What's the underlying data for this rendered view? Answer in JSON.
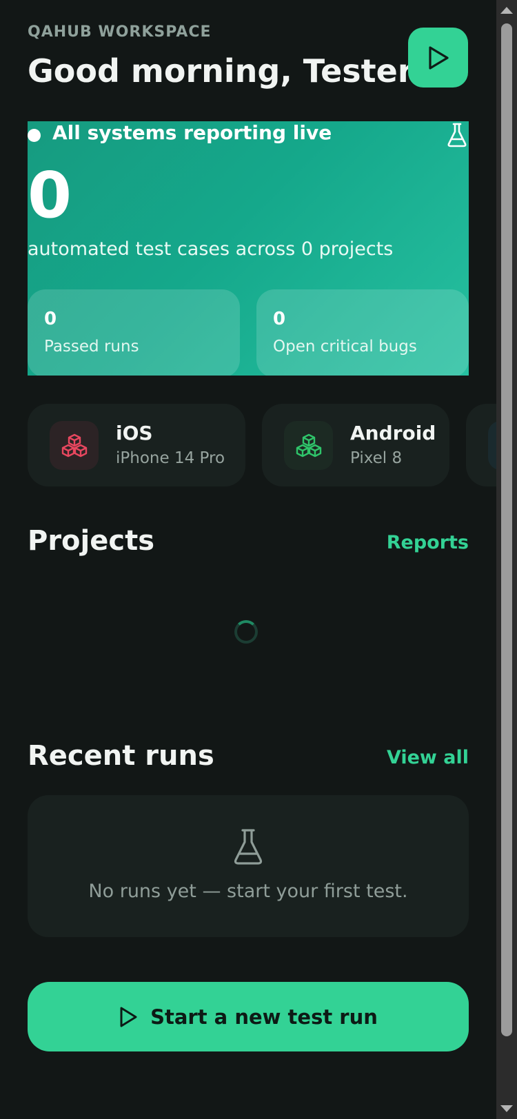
{
  "header": {
    "workspace": "QAHUB WORKSPACE",
    "greeting": "Good morning, Tester"
  },
  "hero": {
    "status": "All systems reporting live",
    "count": "0",
    "subtitle": "automated test cases across 0 projects",
    "stats": [
      {
        "value": "0",
        "label": "Passed runs"
      },
      {
        "value": "0",
        "label": "Open critical bugs"
      }
    ]
  },
  "devices": [
    {
      "name": "iOS",
      "model": "iPhone 14 Pro",
      "icon": "cubes-icon",
      "color": "#e8475f"
    },
    {
      "name": "Android",
      "model": "Pixel 8",
      "icon": "cubes-icon",
      "color": "#2fc46a"
    }
  ],
  "projects": {
    "title": "Projects",
    "link": "Reports"
  },
  "recent": {
    "title": "Recent runs",
    "link": "View all",
    "empty_text": "No runs yet — start your first test."
  },
  "cta": {
    "label": "Start a new test run"
  },
  "colors": {
    "accent": "#33d295",
    "background": "#121716",
    "card": "#19211f"
  }
}
